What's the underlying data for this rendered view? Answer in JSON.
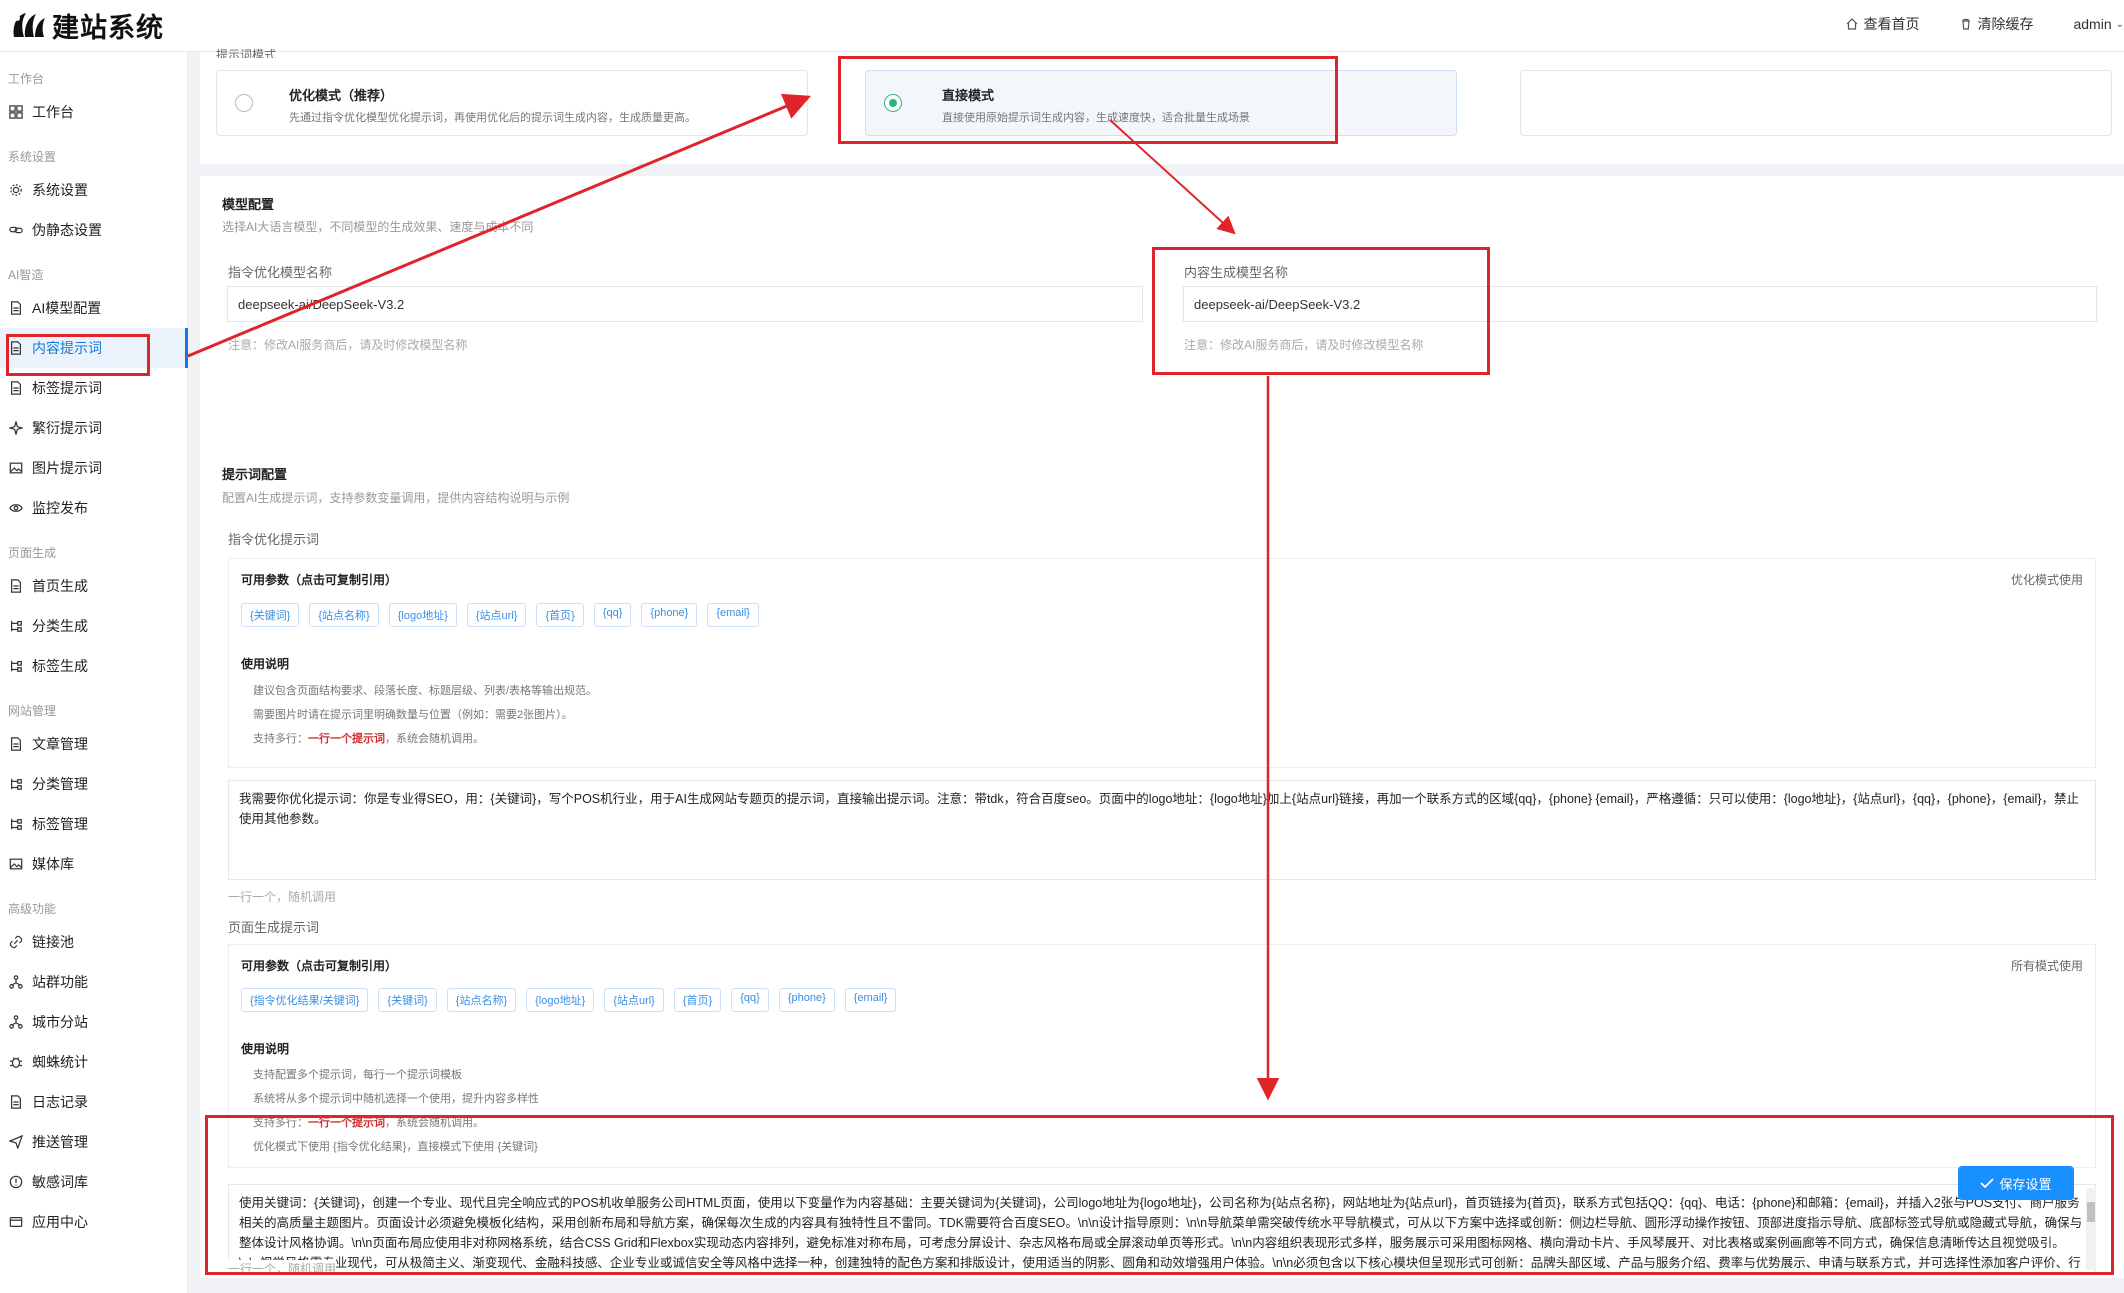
{
  "header": {
    "brand": "建站系统",
    "view_home": "查看首页",
    "clear_cache": "清除缓存",
    "user": "admin"
  },
  "sidebar": {
    "sections": [
      {
        "title": "工作台",
        "items": [
          {
            "label": "工作台",
            "icon": "dashboard-icon"
          }
        ]
      },
      {
        "title": "系统设置",
        "items": [
          {
            "label": "系统设置",
            "icon": "gear-icon"
          },
          {
            "label": "伪静态设置",
            "icon": "link-chain-icon"
          }
        ]
      },
      {
        "title": "AI智造",
        "items": [
          {
            "label": "AI模型配置",
            "icon": "document-icon"
          },
          {
            "label": "内容提示词",
            "icon": "document-icon"
          },
          {
            "label": "标签提示词",
            "icon": "document-icon"
          },
          {
            "label": "繁衍提示词",
            "icon": "sparkle-icon"
          },
          {
            "label": "图片提示词",
            "icon": "image-icon"
          },
          {
            "label": "监控发布",
            "icon": "eye-icon"
          }
        ]
      },
      {
        "title": "页面生成",
        "items": [
          {
            "label": "首页生成",
            "icon": "document-icon"
          },
          {
            "label": "分类生成",
            "icon": "tree-icon"
          },
          {
            "label": "标签生成",
            "icon": "tree-icon"
          }
        ]
      },
      {
        "title": "网站管理",
        "items": [
          {
            "label": "文章管理",
            "icon": "document-icon"
          },
          {
            "label": "分类管理",
            "icon": "tree-icon"
          },
          {
            "label": "标签管理",
            "icon": "tree-icon"
          },
          {
            "label": "媒体库",
            "icon": "image-icon"
          }
        ]
      },
      {
        "title": "高级功能",
        "items": [
          {
            "label": "链接池",
            "icon": "link-icon"
          },
          {
            "label": "站群功能",
            "icon": "cluster-icon"
          },
          {
            "label": "城市分站",
            "icon": "cluster-icon"
          },
          {
            "label": "蜘蛛统计",
            "icon": "bug-icon"
          },
          {
            "label": "日志记录",
            "icon": "document-icon"
          },
          {
            "label": "推送管理",
            "icon": "send-icon"
          },
          {
            "label": "敏感词库",
            "icon": "warning-icon"
          },
          {
            "label": "应用中心",
            "icon": "wallet-icon"
          }
        ]
      }
    ],
    "active_item": "内容提示词"
  },
  "mode": {
    "section_label": "提示词模式",
    "options": [
      {
        "title": "优化模式（推荐）",
        "desc": "先通过指令优化模型优化提示词，再使用优化后的提示词生成内容，生成质量更高。",
        "selected": false
      },
      {
        "title": "直接模式",
        "desc": "直接使用原始提示词生成内容，生成速度快，适合批量生成场景",
        "selected": true
      }
    ]
  },
  "model_config": {
    "title": "模型配置",
    "subtitle": "选择AI大语言模型，不同模型的生成效果、速度与成本不同",
    "optimize_label": "指令优化模型名称",
    "optimize_value": "deepseek-ai/DeepSeek-V3.2",
    "optimize_note": "注意：修改AI服务商后，请及时修改模型名称",
    "content_label": "内容生成模型名称",
    "content_value": "deepseek-ai/DeepSeek-V3.2",
    "content_note": "注意：修改AI服务商后，请及时修改模型名称"
  },
  "prompt_config": {
    "title": "提示词配置",
    "subtitle": "配置AI生成提示词，支持参数变量调用，提供内容结构说明与示例",
    "optimize": {
      "label": "指令优化提示词",
      "params_title": "可用参数（点击可复制引用）",
      "mode_note": "优化模式使用",
      "params": [
        "{关键词}",
        "{站点名称}",
        "{logo地址}",
        "{站点url}",
        "{首页}",
        "{qq}",
        "{phone}",
        "{email}"
      ],
      "usage_title": "使用说明",
      "usage_lines": [
        "建议包含页面结构要求、段落长度、标题层级、列表/表格等输出规范。",
        "需要图片时请在提示词里明确数量与位置（例如：需要2张图片）。"
      ],
      "multi_prefix": "支持多行：",
      "multi_red": "一行一个提示词",
      "multi_suffix": "，系统会随机调用。",
      "text": "我需要你优化提示词：你是专业得SEO，用：{关键词}，写个POS机行业，用于AI生成网站专题页的提示词，直接输出提示词。注意：带tdk，符合百度seo。页面中的logo地址：{logo地址}加上{站点url}链接，再加一个联系方式的区域{qq}，{phone} {email}，严格遵循：只可以使用：{logo地址}，{站点url}，{qq}，{phone}，{email}，禁止使用其他参数。",
      "hint": "一行一个，随机调用"
    },
    "page": {
      "label": "页面生成提示词",
      "params_title": "可用参数（点击可复制引用）",
      "mode_note": "所有模式使用",
      "params": [
        "{指令优化结果/关键词}",
        "{关键词}",
        "{站点名称}",
        "{logo地址}",
        "{站点url}",
        "{首页}",
        "{qq}",
        "{phone}",
        "{email}"
      ],
      "usage_title": "使用说明",
      "usage_lines": [
        "支持配置多个提示词，每行一个提示词模板",
        "系统将从多个提示词中随机选择一个使用，提升内容多样性"
      ],
      "multi_prefix": "支持多行：",
      "multi_red": "一行一个提示词",
      "multi_suffix": "，系统会随机调用。",
      "extra_line": "优化模式下使用 {指令优化结果}，直接模式下使用 {关键词}",
      "text": "使用关键词：{关键词}，创建一个专业、现代且完全响应式的POS机收单服务公司HTML页面，使用以下变量作为内容基础：主要关键词为{关键词}，公司logo地址为{logo地址}，公司名称为{站点名称}，网站地址为{站点url}，首页链接为{首页}，联系方式包括QQ：{qq}、电话：{phone}和邮箱：{email}，并插入2张与POS支付、商户服务相关的高质量主题图片。页面设计必须避免模板化结构，采用创新布局和导航方案，确保每次生成的内容具有独特性且不雷同。TDK需要符合百度SEO。\\n\\n设计指导原则：\\n\\n导航菜单需突破传统水平导航模式，可从以下方案中选择或创新：侧边栏导航、圆形浮动操作按钮、顶部进度指示导航、底部标签式导航或隐藏式导航，确保与整体设计风格协调。\\n\\n页面布局应使用非对称网格系统，结合CSS Grid和Flexbox实现动态内容排列，避免标准对称布局，可考虑分屏设计、杂志风格布局或全屏滚动单页等形式。\\n\\n内容组织表现形式多样，服务展示可采用图标网格、横向滑动卡片、手风琴展开、对比表格或案例画廊等不同方式，确保信息清晰传达且视觉吸引。\\n\\n视觉风格需专业现代，可从极简主义、渐变现代、金融科技感、企业专业或诚信安全等风格中选择一种，创建独特的配色方案和排版设计，使用适当的阴影、圆角和动效增强用户体验。\\n\\n必须包含以下核心模块但呈现形式可创新：品牌头部区域、产品与服务介绍、费率与优势展示、申请与联系方式，并可选择性添加客户评价、行业案例、常见问题或交易数据模拟等交互组件。\\n\\n确保完全响应式设计，在桌面、平板和手机设备上均有良好展现。",
      "hint": "一行一个，随机调用"
    }
  },
  "save_button": "保存设置",
  "colors": {
    "primary": "#1890ff",
    "annotation": "#e0242b",
    "radio_on": "#2db77b",
    "active_bg": "#eaf3fc"
  }
}
